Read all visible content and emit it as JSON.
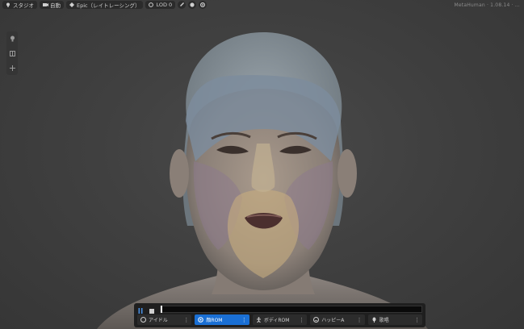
{
  "toolbar": {
    "studio_label": "スタジオ",
    "camera_label": "自動",
    "quality_label": "Epic（レイトレーシング）",
    "lod_label": "LOD 0"
  },
  "watermark": "MetaHuman · 1.08.14 · …",
  "side_tools": [
    "light-icon",
    "grid-icon",
    "plus-icon"
  ],
  "timeline": {
    "progress": 0.0
  },
  "animations": [
    {
      "label": "アイドル",
      "icon": "idle-icon",
      "active": false
    },
    {
      "label": "顔ROM",
      "icon": "face-rom-icon",
      "active": true
    },
    {
      "label": "ボディROM",
      "icon": "body-rom-icon",
      "active": false
    },
    {
      "label": "ハッピーA",
      "icon": "happy-icon",
      "active": false
    },
    {
      "label": "歌唱",
      "icon": "sing-icon",
      "active": false
    }
  ],
  "colors": {
    "accent": "#1a6fd4",
    "toolbar_bg": "#2b2b2b",
    "bar_bg": "#1f1f1f"
  }
}
